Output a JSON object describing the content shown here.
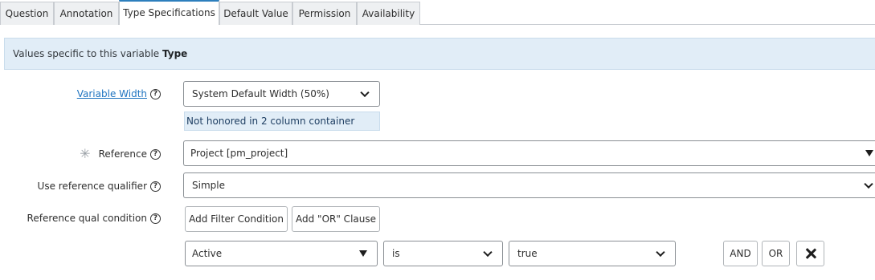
{
  "tabs": [
    {
      "label": "Question"
    },
    {
      "label": "Annotation"
    },
    {
      "label": "Type Specifications"
    },
    {
      "label": "Default Value"
    },
    {
      "label": "Permission"
    },
    {
      "label": "Availability"
    }
  ],
  "active_tab": "Type Specifications",
  "banner": {
    "text": "Values specific to this variable ",
    "bold": "Type"
  },
  "form": {
    "variable_width": {
      "label": "Variable Width",
      "value": "System Default Width (50%)",
      "note": "Not honored in 2 column container"
    },
    "reference": {
      "label": "Reference",
      "value": "Project [pm_project]",
      "required_mark": "✳"
    },
    "use_reference_qualifier": {
      "label": "Use reference qualifier",
      "value": "Simple"
    },
    "reference_qual_condition": {
      "label": "Reference qual condition",
      "add_filter_label": "Add Filter Condition",
      "add_or_label": "Add \"OR\" Clause",
      "condition": {
        "field": "Active",
        "operator": "is",
        "value": "true"
      },
      "and_label": "AND",
      "or_label": "OR"
    }
  },
  "help_glyph": "?",
  "colors": {
    "accent": "#2d7fbd",
    "link": "#1f74c0",
    "banner_bg": "#e1edf7"
  }
}
